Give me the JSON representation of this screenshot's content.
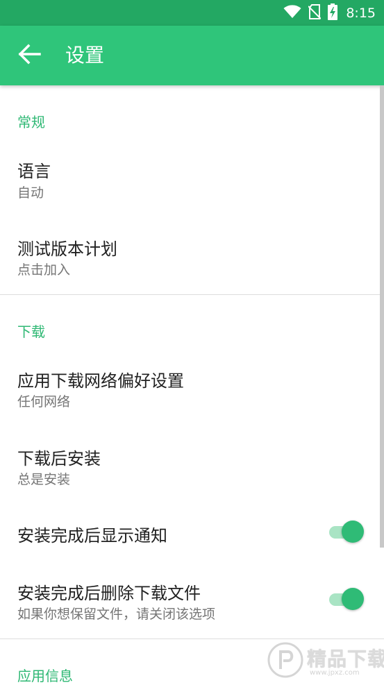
{
  "status_bar": {
    "time": "8:15",
    "icons": [
      "wifi-icon",
      "no-sim-icon",
      "battery-charging-icon"
    ]
  },
  "app_bar": {
    "back_icon": "arrow-left-icon",
    "title": "设置"
  },
  "sections": {
    "general": {
      "header": "常规",
      "language": {
        "title": "语言",
        "value": "自动"
      },
      "beta": {
        "title": "测试版本计划",
        "value": "点击加入"
      }
    },
    "download": {
      "header": "下载",
      "network": {
        "title": "应用下载网络偏好设置",
        "value": "任何网络"
      },
      "install": {
        "title": "下载后安装",
        "value": "总是安装"
      },
      "notify": {
        "title": "安装完成后显示通知",
        "on": true
      },
      "delete": {
        "title": "安装完成后删除下载文件",
        "value": "如果你想保留文件，请关闭该选项",
        "on": true
      }
    },
    "app_info": {
      "header": "应用信息"
    }
  },
  "watermark": {
    "text": "精品下载",
    "sub": "www.jpxz.com"
  },
  "colors": {
    "status_bar": "#23a863",
    "app_bar": "#2fc57a",
    "accent": "#2fb874",
    "toggle_track": "#a9e4c4",
    "toggle_thumb": "#2fbb76"
  }
}
